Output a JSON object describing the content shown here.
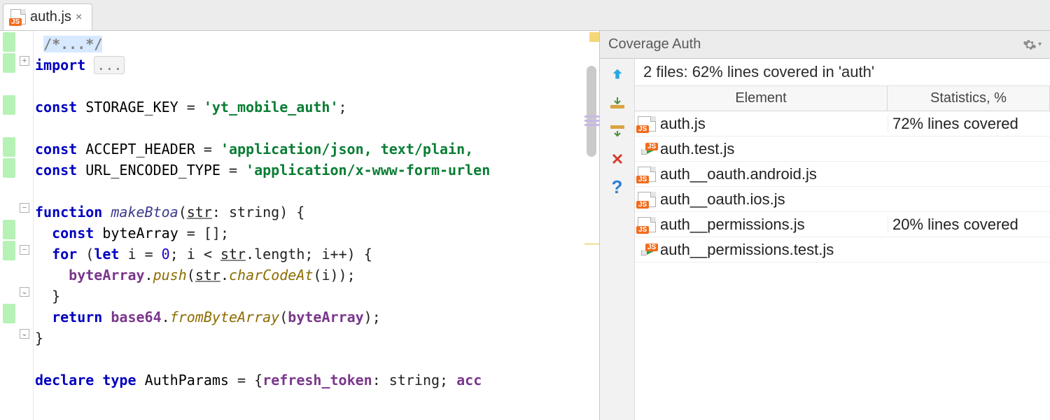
{
  "tab": {
    "filename": "auth.js",
    "filetype": "JS"
  },
  "editor": {
    "comment_fold": "/*...*/",
    "import_kw": "import",
    "fold_ellipsis": "...",
    "const_kw": "const",
    "storage_key_name": "STORAGE_KEY",
    "storage_key_val": "'yt_mobile_auth'",
    "accept_header_name": "ACCEPT_HEADER",
    "accept_header_val": "'application/json, text/plain,",
    "url_encoded_name": "URL_ENCODED_TYPE",
    "url_encoded_val": "'application/x-www-form-urlen",
    "function_kw": "function",
    "makeBtoa_name": "makeBtoa",
    "makeBtoa_param_str": "str",
    "makeBtoa_param_type": "string",
    "bytearray_name": "byteArray",
    "for_kw": "for",
    "let_kw": "let",
    "i_name": "i",
    "zero": "0",
    "str_prop": "length",
    "push_fn": "push",
    "charCodeAt_fn": "charCodeAt",
    "return_kw": "return",
    "base64_name": "base64",
    "fromByteArray_fn": "fromByteArray",
    "declare_kw": "declare",
    "type_kw": "type",
    "authParams_name": "AuthParams",
    "refresh_token_field": "refresh_token",
    "acc_cut": "acc"
  },
  "coverage": {
    "title": "Coverage Auth",
    "summary": "2 files: 62% lines covered in 'auth'",
    "columns": {
      "element": "Element",
      "stats": "Statistics, %"
    },
    "tools": {
      "up": "up-arrow-icon",
      "import": "import-icon",
      "export": "export-icon",
      "close": "close-icon",
      "help": "help-icon"
    },
    "rows": [
      {
        "file": "auth.js",
        "stat": "72% lines covered",
        "test": false
      },
      {
        "file": "auth.test.js",
        "stat": "",
        "test": true
      },
      {
        "file": "auth__oauth.android.js",
        "stat": "",
        "test": false
      },
      {
        "file": "auth__oauth.ios.js",
        "stat": "",
        "test": false
      },
      {
        "file": "auth__permissions.js",
        "stat": "20% lines covered",
        "test": false
      },
      {
        "file": "auth__permissions.test.js",
        "stat": "",
        "test": true
      }
    ]
  }
}
